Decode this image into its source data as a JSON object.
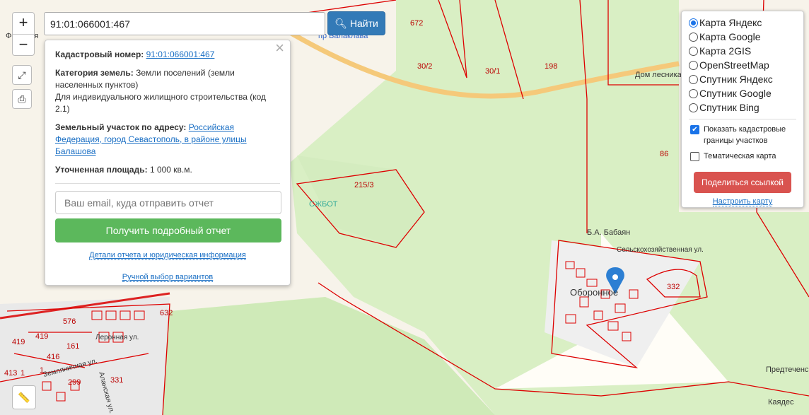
{
  "search": {
    "value": "91:01:066001:467",
    "button": "Найти"
  },
  "zoom": {
    "in": "+",
    "out": "−"
  },
  "popup": {
    "cad_label": "Кадастровый номер:",
    "cad_value": "91:01:066001:467",
    "cat_label": "Категория земель:",
    "cat_value": "Земли поселений (земли населенных пунктов)",
    "use": "Для индивидуального жилищного строительства (код 2.1)",
    "addr_label": "Земельный участок по адресу:",
    "addr_value": "Российская Федерация, город Севастополь, в районе улицы Балашова",
    "area_label": "Уточненная площадь:",
    "area_value": "1 000 кв.м.",
    "email_placeholder": "Ваш email, куда отправить отчет",
    "report_button": "Получить подробный отчет",
    "details_link": "Детали отчета и юридическая информация",
    "manual_link": "Ручной выбор вариантов"
  },
  "layers": {
    "options": [
      {
        "label": "Карта Яндекс",
        "selected": true
      },
      {
        "label": "Карта Google",
        "selected": false
      },
      {
        "label": "Карта 2GIS",
        "selected": false
      },
      {
        "label": "OpenStreetMap",
        "selected": false
      },
      {
        "label": "Спутник Яндекс",
        "selected": false
      },
      {
        "label": "Спутник Google",
        "selected": false
      },
      {
        "label": "Спутник Bing",
        "selected": false
      }
    ],
    "show_borders": "Показать кадастровые границы участков",
    "thematic": "Тематическая карта",
    "share": "Поделиться ссылкой",
    "configure": "Настроить карту"
  },
  "map": {
    "parcels": [
      "672",
      "30/2",
      "30/1",
      "198",
      "86",
      "215/3",
      "332",
      "632",
      "576",
      "419",
      "419",
      "161",
      "416",
      "413",
      "1",
      "1",
      "299",
      "331"
    ],
    "places": [
      "Дом лесника",
      "СЖБОТ",
      "Б.А. Бабаян",
      "Сельскохозяйственная ул.",
      "Оборонное",
      "Предтеченская церковь",
      "Каядес",
      "Леронная ул.",
      "Земляничная ул.",
      "Аланская ул.",
      "пр Балаклава",
      "Фемерия"
    ]
  }
}
